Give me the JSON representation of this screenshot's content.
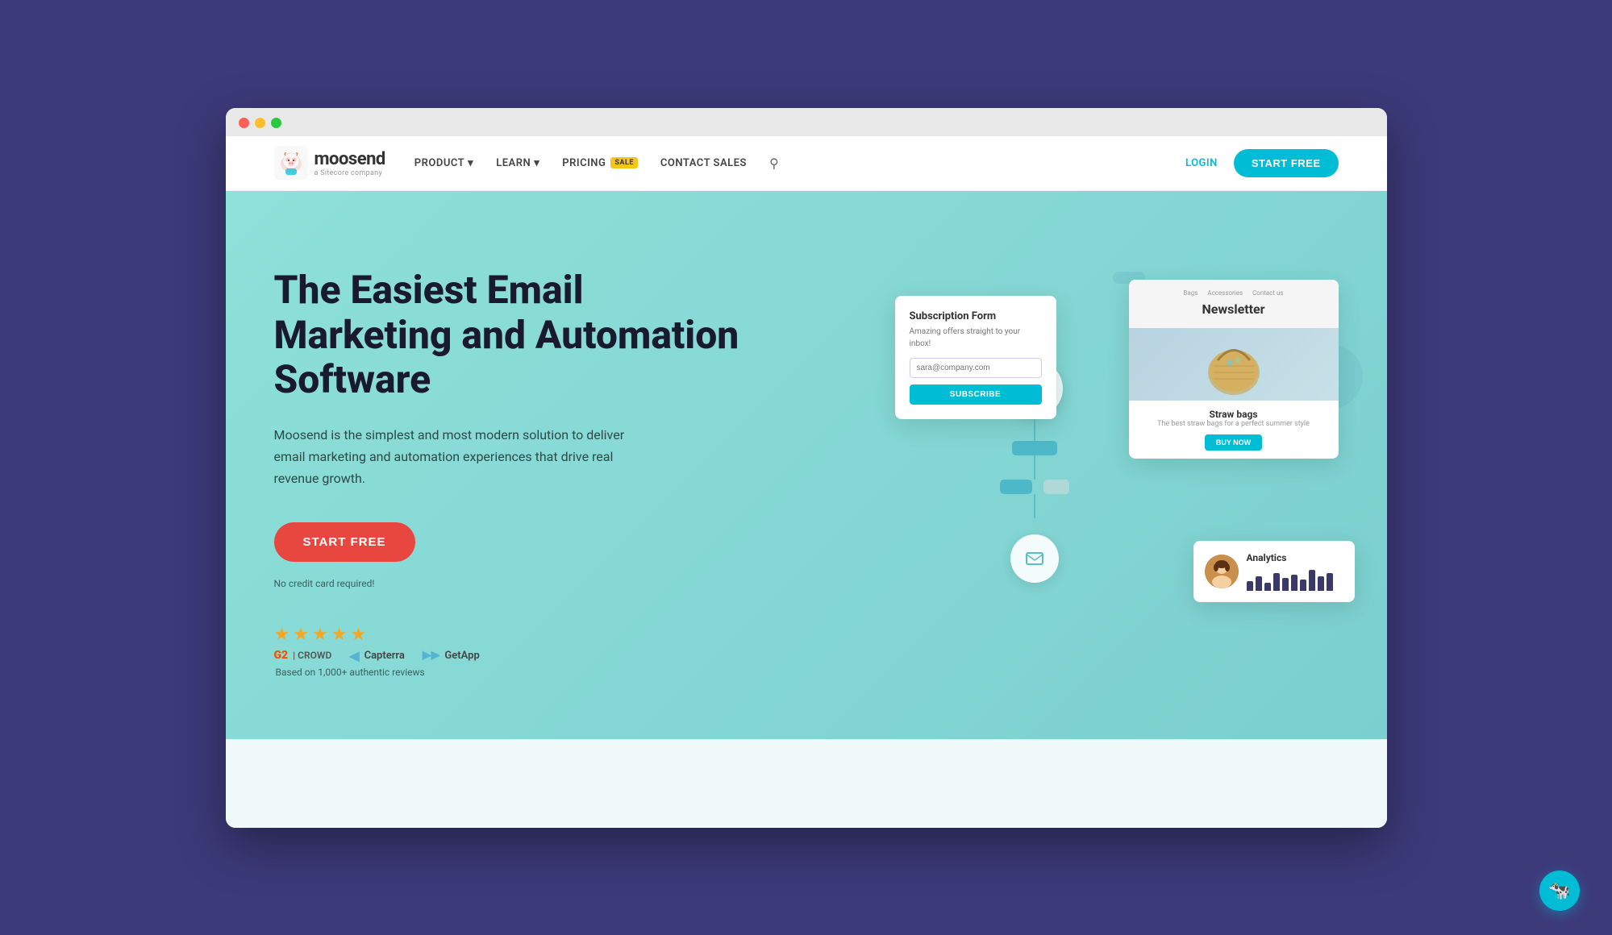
{
  "browser": {
    "traffic_lights": [
      "red",
      "yellow",
      "green"
    ]
  },
  "navbar": {
    "logo_name": "moosend",
    "logo_subtitle": "a Sitecore company",
    "product_label": "PRODUCT",
    "learn_label": "LEARN",
    "pricing_label": "PRICING",
    "pricing_badge": "SALE",
    "contact_sales_label": "CONTACT SALES",
    "login_label": "LOGIN",
    "start_free_label": "START FREE"
  },
  "hero": {
    "title": "The Easiest Email Marketing and Automation Software",
    "description": "Moosend is the simplest and most modern solution to deliver email marketing and automation experiences that drive real revenue growth.",
    "start_free_btn": "START FREE",
    "no_credit": "No credit card required!",
    "reviews_text": "Based on 1,000+ authentic reviews",
    "stars_count": 5,
    "review_logos": [
      {
        "name": "G2 CROWD",
        "icon": "G2"
      },
      {
        "name": "Capterra",
        "icon": "▲"
      },
      {
        "name": "GetApp",
        "icon": "»"
      }
    ]
  },
  "subscription_card": {
    "title": "Subscription Form",
    "description": "Amazing offers straight to your inbox!",
    "input_placeholder": "sara@company.com",
    "button_label": "SUBSCRIBE"
  },
  "newsletter_card": {
    "title": "Newsletter",
    "nav_items": [
      "Bags",
      "Accessories",
      "Contact us"
    ],
    "product_name": "Straw bags",
    "product_desc": "The best straw bags for a perfect summer style",
    "buy_btn": "Buy Now"
  },
  "analytics_card": {
    "title": "Analytics",
    "bars": [
      12,
      18,
      10,
      22,
      16,
      20,
      14,
      26,
      18,
      22
    ]
  },
  "automation": {
    "step1_icon": "☰",
    "step2_icon": "✉"
  },
  "chat": {
    "icon": "🐮"
  }
}
